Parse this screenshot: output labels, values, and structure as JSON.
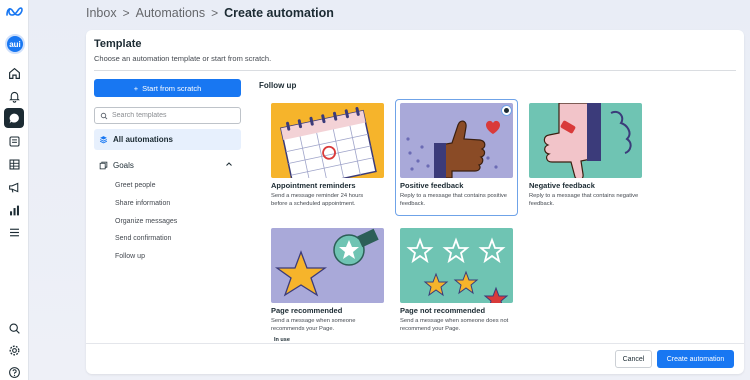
{
  "breadcrumb": {
    "items": [
      "Inbox",
      "Automations",
      "Create automation"
    ],
    "separator": ">"
  },
  "avatar": {
    "initials": "aui"
  },
  "rail": {
    "icons": [
      "meta-logo-icon",
      "home-icon",
      "bell-icon",
      "chat-icon",
      "posts-icon",
      "table-icon",
      "megaphone-icon",
      "insights-icon",
      "menu-icon",
      "search-icon",
      "settings-icon",
      "help-icon"
    ]
  },
  "panel": {
    "title": "Template",
    "subtitle": "Choose an automation template or start from scratch."
  },
  "sidebar": {
    "start_button": "Start from scratch",
    "search_placeholder": "Search templates",
    "all_label": "All automations",
    "goals_label": "Goals",
    "goal_items": [
      "Greet people",
      "Share information",
      "Organize messages",
      "Send confirmation",
      "Follow up"
    ]
  },
  "section": {
    "title": "Follow up"
  },
  "cards": [
    {
      "title": "Appointment reminders",
      "desc": "Send a message reminder 24 hours before a scheduled appointment."
    },
    {
      "title": "Positive feedback",
      "desc": "Reply to a message that contains positive feedback."
    },
    {
      "title": "Negative feedback",
      "desc": "Reply to a message that contains negative feedback."
    },
    {
      "title": "Page recommended",
      "desc": "Send a message when someone recommends your Page.",
      "badge": "In use"
    },
    {
      "title": "Page not recommended",
      "desc": "Send a message when someone does not recommend your Page."
    }
  ],
  "footer": {
    "cancel": "Cancel",
    "create": "Create automation"
  },
  "colors": {
    "accent": "#1877f2",
    "selected_bg": "#e7f0fd"
  }
}
